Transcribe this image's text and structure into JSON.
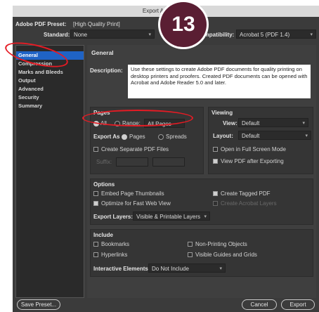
{
  "window": {
    "title": "Export Adobe PDF"
  },
  "header": {
    "preset_label": "Adobe PDF Preset:",
    "preset_value": "[High Quality Print]",
    "standard_label": "Standard:",
    "standard_value": "None",
    "compat_label": "Compatibility:",
    "compat_value": "Acrobat 5 (PDF 1.4)"
  },
  "sidebar": {
    "items": [
      {
        "label": "General"
      },
      {
        "label": "Compression"
      },
      {
        "label": "Marks and Bleeds"
      },
      {
        "label": "Output"
      },
      {
        "label": "Advanced"
      },
      {
        "label": "Security"
      },
      {
        "label": "Summary"
      }
    ]
  },
  "general": {
    "heading": "General",
    "description_label": "Description:",
    "description_text": "Use these settings to create Adobe PDF documents for quality printing on desktop printers and proofers.  Created PDF documents can be opened with Acrobat and Adobe Reader 5.0 and later."
  },
  "pages": {
    "heading": "Pages",
    "all_label": "All",
    "range_label": "Range:",
    "range_value": "All Pages",
    "export_as_label": "Export As",
    "pages_label": "Pages",
    "spreads_label": "Spreads",
    "separate_label": "Create Separate PDF Files",
    "suffix_label": "Suffix:"
  },
  "viewing": {
    "heading": "Viewing",
    "view_label": "View:",
    "view_value": "Default",
    "layout_label": "Layout:",
    "layout_value": "Default",
    "fullscreen_label": "Open in Full Screen Mode",
    "viewafter_label": "View PDF after Exporting"
  },
  "options": {
    "heading": "Options",
    "embed_label": "Embed Page Thumbnails",
    "tagged_label": "Create Tagged PDF",
    "optimize_label": "Optimize for Fast Web View",
    "acrobat_layers_label": "Create Acrobat Layers",
    "export_layers_label": "Export Layers:",
    "export_layers_value": "Visible & Printable Layers"
  },
  "include": {
    "heading": "Include",
    "bookmarks_label": "Bookmarks",
    "nonprinting_label": "Non-Printing Objects",
    "hyperlinks_label": "Hyperlinks",
    "guides_label": "Visible Guides and Grids",
    "interactive_label": "Interactive Elements:",
    "interactive_value": "Do Not Include"
  },
  "footer": {
    "save_preset": "Save Preset...",
    "cancel": "Cancel",
    "export": "Export"
  },
  "annotation": {
    "step_number": "13",
    "highlight_color": "#e51b24",
    "badge_color": "#5a1e33"
  },
  "colors": {
    "accent": "#1f63c5",
    "panel": "#3b3b3b"
  }
}
